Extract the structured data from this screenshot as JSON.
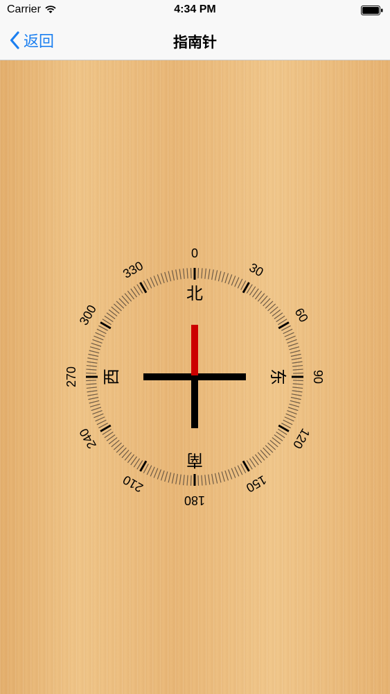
{
  "status_bar": {
    "carrier": "Carrier",
    "time": "4:34 PM",
    "wifi_icon": "wifi-icon",
    "battery_icon": "battery-icon"
  },
  "nav": {
    "back_label": "返回",
    "title": "指南针",
    "back_icon": "chevron-left-icon",
    "accent_color": "#1b7ff0"
  },
  "compass": {
    "directions": {
      "north": "北",
      "east": "东",
      "south": "南",
      "west": "西"
    },
    "degree_labels": [
      "0",
      "30",
      "60",
      "90",
      "120",
      "150",
      "180",
      "210",
      "240",
      "270",
      "300",
      "330"
    ],
    "heading": 0,
    "needle_north_color": "#cc0000",
    "needle_color": "#000000"
  }
}
